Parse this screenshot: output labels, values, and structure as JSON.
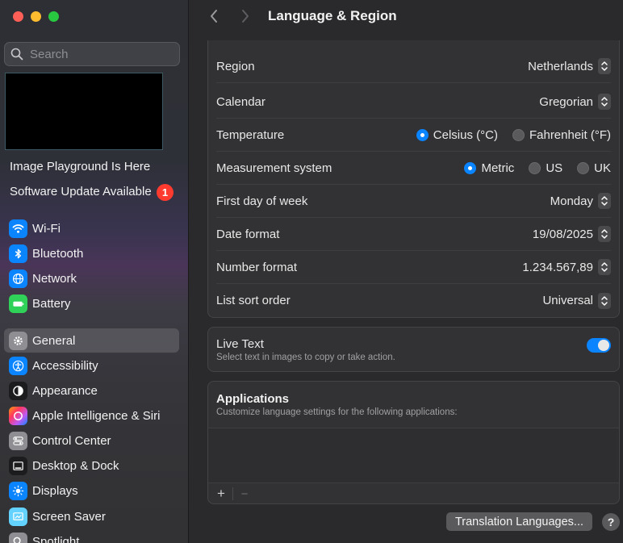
{
  "window": {
    "title": "Language & Region"
  },
  "sidebar": {
    "search_placeholder": "Search",
    "notices": [
      {
        "label": "Image Playground Is Here"
      },
      {
        "label": "Software Update Available",
        "badge": "1"
      }
    ],
    "items": [
      {
        "label": "Wi-Fi",
        "icon": "wifi-icon",
        "color": "#0a84ff"
      },
      {
        "label": "Bluetooth",
        "icon": "bluetooth-icon",
        "color": "#0a84ff"
      },
      {
        "label": "Network",
        "icon": "globe-icon",
        "color": "#0a84ff"
      },
      {
        "label": "Battery",
        "icon": "battery-icon",
        "color": "#30d158"
      },
      {
        "label": "General",
        "icon": "gear-icon",
        "color": "#8e8e93",
        "selected": true
      },
      {
        "label": "Accessibility",
        "icon": "accessibility-icon",
        "color": "#0a84ff"
      },
      {
        "label": "Appearance",
        "icon": "appearance-icon",
        "color": "#1c1c1e"
      },
      {
        "label": "Apple Intelligence & Siri",
        "icon": "siri-icon",
        "color": "#bf5af2"
      },
      {
        "label": "Control Center",
        "icon": "control-center-icon",
        "color": "#8e8e93"
      },
      {
        "label": "Desktop & Dock",
        "icon": "dock-icon",
        "color": "#1c1c1e"
      },
      {
        "label": "Displays",
        "icon": "displays-icon",
        "color": "#0a84ff"
      },
      {
        "label": "Screen Saver",
        "icon": "screen-saver-icon",
        "color": "#64d2ff"
      },
      {
        "label": "Spotlight",
        "icon": "spotlight-icon",
        "color": "#8e8e93"
      }
    ]
  },
  "settings": {
    "rows": [
      {
        "label": "Region",
        "value": "Netherlands"
      },
      {
        "label": "Calendar",
        "value": "Gregorian"
      },
      {
        "label": "Temperature",
        "options": [
          "Celsius (°C)",
          "Fahrenheit (°F)"
        ],
        "selected": "Celsius (°C)"
      },
      {
        "label": "Measurement system",
        "options": [
          "Metric",
          "US",
          "UK"
        ],
        "selected": "Metric"
      },
      {
        "label": "First day of week",
        "value": "Monday"
      },
      {
        "label": "Date format",
        "value": "19/08/2025"
      },
      {
        "label": "Number format",
        "value": "1.234.567,89"
      },
      {
        "label": "List sort order",
        "value": "Universal"
      }
    ],
    "live_text": {
      "label": "Live Text",
      "description": "Select text in images to copy or take action.",
      "enabled": true
    },
    "applications": {
      "title": "Applications",
      "description": "Customize language settings for the following applications:",
      "add": "+",
      "remove": "−"
    },
    "translation_button": "Translation Languages...",
    "help": "?"
  },
  "colors": {
    "accent": "#0a84ff",
    "badge": "#ff3b30"
  }
}
